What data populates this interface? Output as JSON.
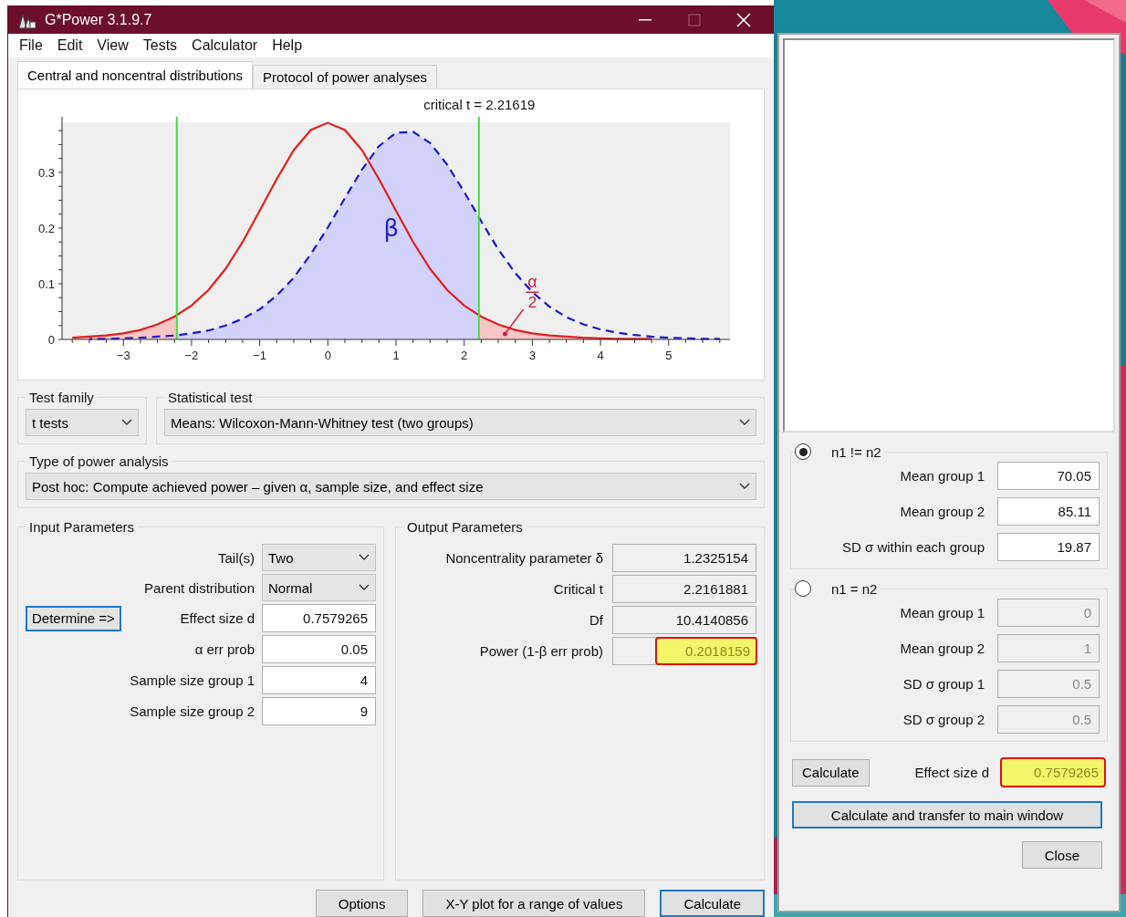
{
  "window": {
    "title": "G*Power 3.1.9.7"
  },
  "menu": [
    "File",
    "Edit",
    "View",
    "Tests",
    "Calculator",
    "Help"
  ],
  "tabs": [
    {
      "label": "Central and noncentral distributions",
      "selected": true
    },
    {
      "label": "Protocol of power analyses",
      "selected": false
    }
  ],
  "chart": {
    "chart_data": {
      "type": "line",
      "title": "critical t = 2.21619",
      "x": [
        -3.75,
        -3.5,
        -3.25,
        -3,
        -2.75,
        -2.5,
        -2.25,
        -2,
        -1.75,
        -1.5,
        -1.25,
        -1,
        -0.75,
        -0.5,
        -0.25,
        0,
        0.25,
        0.5,
        0.75,
        1,
        1.25,
        1.5,
        1.75,
        2,
        2.25,
        2.5,
        2.75,
        3,
        3.25,
        3.5,
        3.75,
        4,
        4.25,
        4.5,
        4.75,
        5,
        5.25,
        5.5,
        5.75
      ],
      "series": [
        {
          "color": "#e02020",
          "line_style": "solid",
          "values": [
            0.003,
            0.005,
            0.007,
            0.011,
            0.017,
            0.027,
            0.041,
            0.061,
            0.089,
            0.127,
            0.175,
            0.231,
            0.288,
            0.34,
            0.376,
            0.389,
            0.376,
            0.34,
            0.288,
            0.231,
            0.175,
            0.127,
            0.089,
            0.061,
            0.041,
            0.027,
            0.017,
            0.011,
            0.007,
            0.005,
            0.003,
            0.002,
            0.001,
            0.001,
            0.001,
            null,
            null,
            null,
            null
          ]
        },
        {
          "color": "#1a1acc",
          "line_style": "dashed",
          "values": [
            null,
            0.001,
            0.001,
            0.002,
            0.003,
            0.005,
            0.007,
            0.011,
            0.016,
            0.025,
            0.037,
            0.054,
            0.079,
            0.111,
            0.153,
            0.201,
            0.254,
            0.305,
            0.347,
            0.371,
            0.373,
            0.353,
            0.314,
            0.265,
            0.212,
            0.162,
            0.119,
            0.085,
            0.059,
            0.04,
            0.027,
            0.018,
            0.012,
            0.008,
            0.005,
            0.003,
            0.002,
            0.001,
            0.001
          ]
        }
      ],
      "xlim": [
        -3.9,
        5.9
      ],
      "ylim": [
        0,
        0.39
      ],
      "xticks": [
        -3,
        -2,
        -1,
        0,
        1,
        2,
        3,
        4,
        5
      ],
      "yticks": [
        0,
        0.1,
        0.2,
        0.3
      ],
      "ref_lines": [
        {
          "axis": "x",
          "value": -2.21619,
          "color": "#3ee03e"
        },
        {
          "axis": "x",
          "value": 2.21619,
          "color": "#3ee03e"
        }
      ],
      "annotations": [
        "β",
        "α",
        "2"
      ]
    }
  },
  "test_family": {
    "label": "Test family",
    "value": "t tests"
  },
  "statistical_test": {
    "label": "Statistical test",
    "value": "Means: Wilcoxon-Mann-Whitney test (two groups)"
  },
  "power_analysis_type": {
    "label": "Type of power analysis",
    "value": "Post hoc: Compute achieved power – given α, sample size, and effect size"
  },
  "input_parameters": {
    "title": "Input Parameters",
    "rows": [
      {
        "label": "Tail(s)",
        "kind": "dropdown",
        "value": "Two"
      },
      {
        "label": "Parent distribution",
        "kind": "dropdown",
        "value": "Normal"
      },
      {
        "label": "Effect size d",
        "kind": "field",
        "value": "0.7579265",
        "button": "Determine =>"
      },
      {
        "label": "α err prob",
        "kind": "field",
        "value": "0.05"
      },
      {
        "label": "Sample size group 1",
        "kind": "field",
        "value": "4"
      },
      {
        "label": "Sample size group 2",
        "kind": "field",
        "value": "9"
      }
    ]
  },
  "output_parameters": {
    "title": "Output Parameters",
    "rows": [
      {
        "label": "Noncentrality parameter δ",
        "value": "1.2325154",
        "highlighted": false
      },
      {
        "label": "Critical t",
        "value": "2.2161881",
        "highlighted": false
      },
      {
        "label": "Df",
        "value": "10.4140856",
        "highlighted": false
      },
      {
        "label": "Power (1-β err prob)",
        "value": "0.2018159",
        "highlighted": true
      }
    ]
  },
  "buttons": [
    {
      "label": "Options",
      "focused": false
    },
    {
      "label": "X-Y plot for a range of values",
      "focused": false
    },
    {
      "label": "Calculate",
      "focused": true
    }
  ],
  "effect_size_dialog": {
    "options": [
      {
        "label": "n1 != n2",
        "selected": true,
        "fields": [
          {
            "label": "Mean group 1",
            "value": "70.05"
          },
          {
            "label": "Mean group 2",
            "value": "85.11"
          },
          {
            "label": "SD σ within each group",
            "value": "19.87"
          }
        ]
      },
      {
        "label": "n1 = n2",
        "selected": false,
        "fields": [
          {
            "label": "Mean group 1",
            "value": "0"
          },
          {
            "label": "Mean group 2",
            "value": "1"
          },
          {
            "label": "SD σ group 1",
            "value": "0.5"
          },
          {
            "label": "SD σ group 2",
            "value": "0.5"
          }
        ]
      }
    ],
    "calculate_button": "Calculate",
    "effect_size_label": "Effect size d",
    "effect_size_value": "0.7579265",
    "effect_size_highlighted": true,
    "transfer_button": "Calculate and transfer to main window",
    "close_button": "Close"
  }
}
